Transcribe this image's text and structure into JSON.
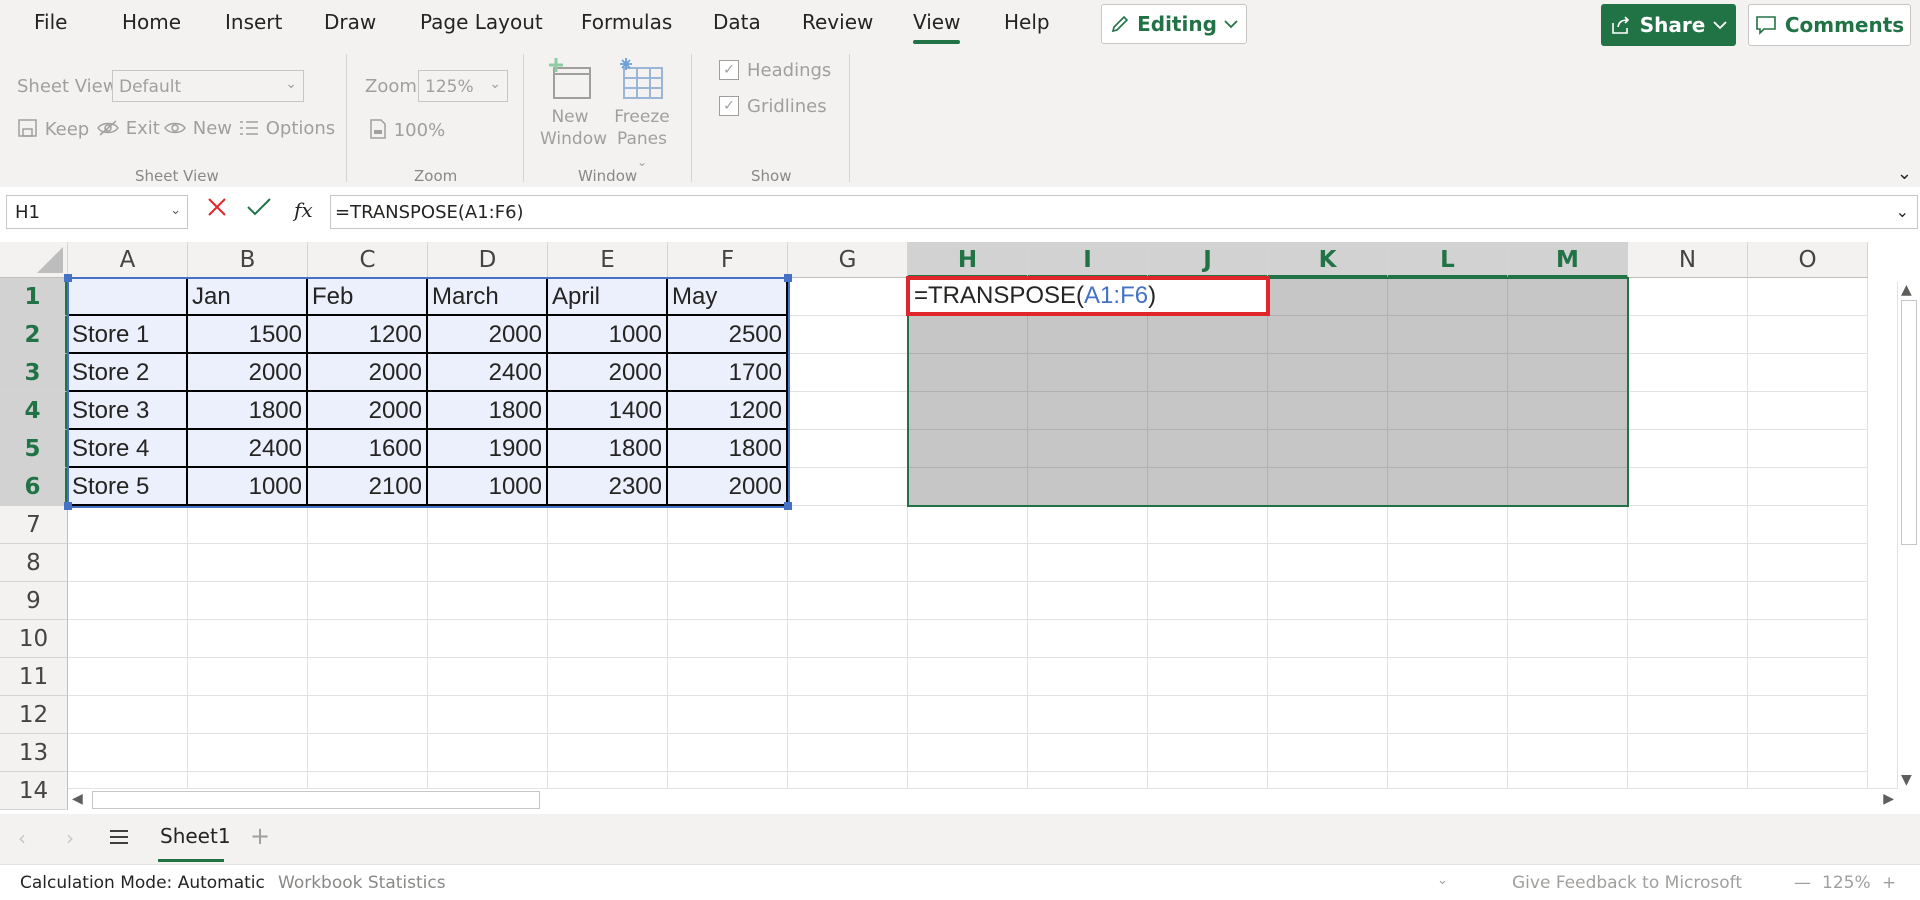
{
  "menu": {
    "items": [
      "File",
      "Home",
      "Insert",
      "Draw",
      "Page Layout",
      "Formulas",
      "Data",
      "Review",
      "View",
      "Help"
    ],
    "active": "View",
    "editing_label": "Editing",
    "share_label": "Share",
    "comments_label": "Comments"
  },
  "ribbon": {
    "sheet_view": {
      "label": "Sheet View",
      "select_value": "Default",
      "keep": "Keep",
      "exit": "Exit",
      "new": "New",
      "options": "Options",
      "group_label": "Sheet View"
    },
    "zoom": {
      "label": "Zoom",
      "select_value": "125%",
      "hundred": "100%",
      "group_label": "Zoom"
    },
    "window": {
      "new_window_1": "New",
      "new_window_2": "Window",
      "freeze_1": "Freeze",
      "freeze_2": "Panes",
      "group_label": "Window"
    },
    "show": {
      "headings": "Headings",
      "gridlines": "Gridlines",
      "group_label": "Show"
    }
  },
  "formula_bar": {
    "name_box": "H1",
    "fx": "fx",
    "formula": "=TRANSPOSE(A1:F6)"
  },
  "grid": {
    "columns": [
      "A",
      "B",
      "C",
      "D",
      "E",
      "F",
      "G",
      "H",
      "I",
      "J",
      "K",
      "L",
      "M",
      "N",
      "O"
    ],
    "selected_columns": [
      "H",
      "I",
      "J",
      "K",
      "L",
      "M"
    ],
    "rows": [
      "1",
      "2",
      "3",
      "4",
      "5",
      "6",
      "7",
      "8",
      "9",
      "10",
      "11",
      "12",
      "13",
      "14"
    ],
    "selected_rows": [
      "1",
      "2",
      "3",
      "4",
      "5",
      "6"
    ],
    "table": [
      [
        "",
        "Jan",
        "Feb",
        "March",
        "April",
        "May"
      ],
      [
        "Store 1",
        "1500",
        "1200",
        "2000",
        "1000",
        "2500"
      ],
      [
        "Store 2",
        "2000",
        "2000",
        "2400",
        "2000",
        "1700"
      ],
      [
        "Store 3",
        "1800",
        "2000",
        "1800",
        "1400",
        "1200"
      ],
      [
        "Store 4",
        "2400",
        "1600",
        "1900",
        "1800",
        "1800"
      ],
      [
        "Store 5",
        "1000",
        "2100",
        "1000",
        "2300",
        "2000"
      ]
    ],
    "edit_cell": {
      "prefix": "=TRANSPOSE(",
      "ref": "A1:F6",
      "suffix": ")"
    }
  },
  "sheets": {
    "active": "Sheet1"
  },
  "status": {
    "calc_mode": "Calculation Mode: Automatic",
    "workbook_stats": "Workbook Statistics",
    "feedback": "Give Feedback to Microsoft",
    "zoom": "125%"
  },
  "colors": {
    "accent": "#217346",
    "reference_blue": "#4472c4",
    "edit_border": "#e0262a",
    "table_fill": "#ecf0fc",
    "selection_fill": "#c6c6c6"
  }
}
